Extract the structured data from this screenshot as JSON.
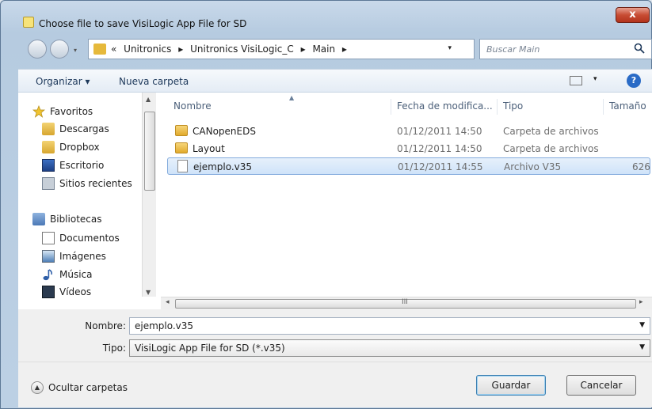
{
  "window": {
    "title": "Choose file to save VisiLogic App File for SD",
    "close_label": "x"
  },
  "nav": {
    "breadcrumb": [
      "«",
      "Unitronics",
      "▸",
      "Unitronics VisiLogic_C",
      "▸",
      "Main",
      "▸"
    ],
    "search_placeholder": "Buscar Main"
  },
  "toolbar": {
    "organize_label": "Organizar ▾",
    "new_folder_label": "Nueva carpeta",
    "help_label": "?"
  },
  "sidebar": {
    "favorites_label": "Favoritos",
    "favorites": [
      {
        "label": "Descargas",
        "icon": "downloads-icon"
      },
      {
        "label": "Dropbox",
        "icon": "dropbox-icon"
      },
      {
        "label": "Escritorio",
        "icon": "desktop-icon"
      },
      {
        "label": "Sitios recientes",
        "icon": "recent-places-icon"
      }
    ],
    "libraries_label": "Bibliotecas",
    "libraries": [
      {
        "label": "Documentos",
        "icon": "documents-icon"
      },
      {
        "label": "Imágenes",
        "icon": "pictures-icon"
      },
      {
        "label": "Música",
        "icon": "music-icon"
      },
      {
        "label": "Vídeos",
        "icon": "videos-icon"
      }
    ]
  },
  "files": {
    "columns": {
      "name": "Nombre",
      "date": "Fecha de modifica...",
      "type": "Tipo",
      "size": "Tamaño"
    },
    "rows": [
      {
        "name": "CANopenEDS",
        "date": "01/12/2011 14:50",
        "type": "Carpeta de archivos",
        "size": "",
        "kind": "folder"
      },
      {
        "name": "Layout",
        "date": "01/12/2011 14:50",
        "type": "Carpeta de archivos",
        "size": "",
        "kind": "folder"
      },
      {
        "name": "ejemplo.v35",
        "date": "01/12/2011 14:55",
        "type": "Archivo V35",
        "size": "626",
        "kind": "file"
      }
    ]
  },
  "form": {
    "filename_label": "Nombre:",
    "filename_value": "ejemplo.v35",
    "type_label": "Tipo:",
    "type_value": "VisiLogic App File for SD (*.v35)"
  },
  "footer": {
    "hide_folders_label": "Ocultar carpetas",
    "save_label": "Guardar",
    "cancel_label": "Cancelar"
  },
  "colors": {
    "selection": "#cfe3f9",
    "accent": "#3c7fb1"
  }
}
